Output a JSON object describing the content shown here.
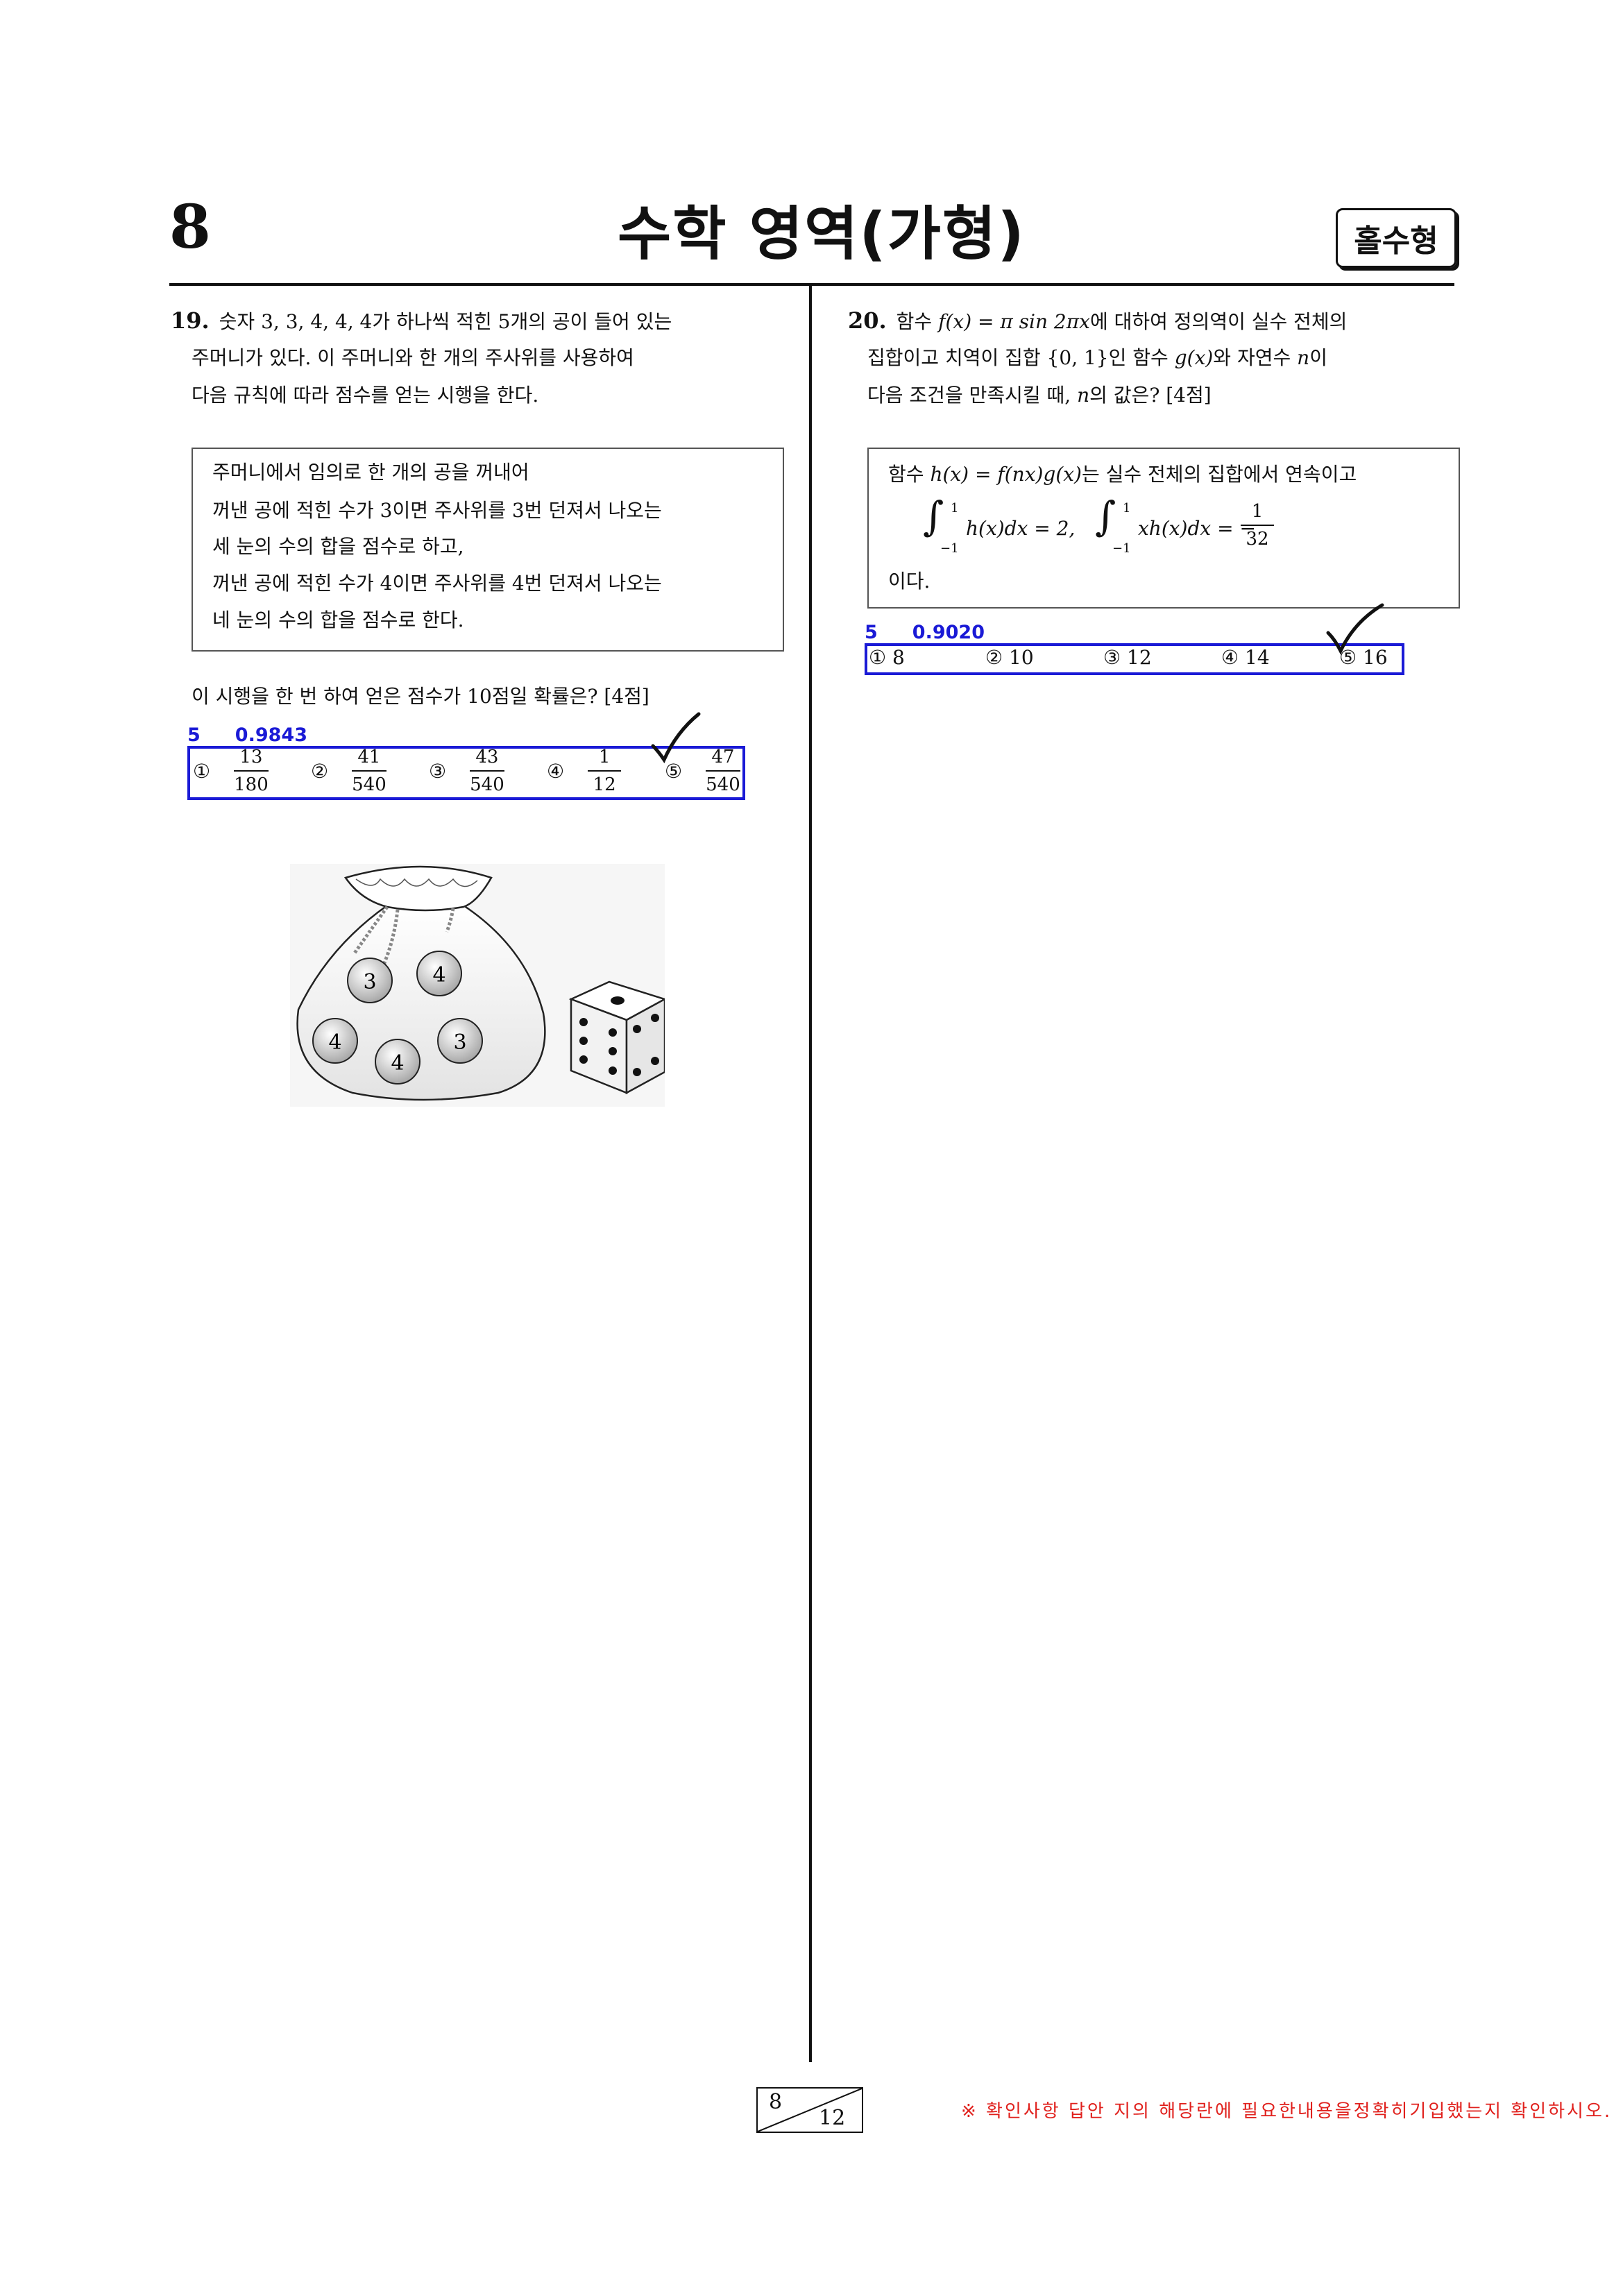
{
  "header": {
    "page_number": "8",
    "title": "수학 영역(가형)",
    "exam_type": "홀수형"
  },
  "q19": {
    "number": "19.",
    "lines": [
      "숫자 3, 3, 4, 4, 4가 하나씩 적힌 5개의 공이 들어 있는",
      "주머니가 있다. 이 주머니와 한 개의 주사위를 사용하여",
      "다음 규칙에 따라 점수를 얻는 시행을 한다."
    ],
    "rule_lines": [
      "주머니에서 임의로 한 개의 공을 꺼내어",
      "꺼낸 공에 적힌 수가 3이면 주사위를 3번 던져서 나오는",
      "세 눈의 수의 합을 점수로 하고,",
      "꺼낸 공에 적힌 수가 4이면 주사위를 4번 던져서 나오는",
      "네 눈의 수의 합을 점수로 한다."
    ],
    "question": "이 시행을 한 번 하여 얻은 점수가 10점일 확률은? [4점]",
    "answer": "5",
    "confidence": "0.9843",
    "choices": [
      {
        "mark": "①",
        "num": "13",
        "den": "180"
      },
      {
        "mark": "②",
        "num": "41",
        "den": "540"
      },
      {
        "mark": "③",
        "num": "43",
        "den": "540"
      },
      {
        "mark": "④",
        "num": "1",
        "den": "12"
      },
      {
        "mark": "⑤",
        "num": "47",
        "den": "540"
      }
    ],
    "balls": [
      "3",
      "4",
      "4",
      "3",
      "4"
    ]
  },
  "q20": {
    "number": "20.",
    "line1_a": "함수",
    "line1_f": "f(x) = π sin 2πx",
    "line1_b": "에 대하여 정의역이 실수 전체의",
    "line2_a": "집합이고 치역이 집합",
    "line2_set": "{0, 1}",
    "line2_b": "인 함수",
    "line2_g": "g(x)",
    "line2_c": "와 자연수",
    "line2_n": "n",
    "line2_d": "이",
    "line3_a": "다음 조건을 만족시킬 때,",
    "line3_n": "n",
    "line3_b": "의 값은? [4점]",
    "cond_a": "함수",
    "cond_h": "h(x) = f(nx)g(x)",
    "cond_b": "는 실수 전체의 집합에서 연속이고",
    "int1_body": "h(x)dx = 2,",
    "int2_body": "xh(x)dx = −",
    "int_upper": "1",
    "int_lower": "−1",
    "frac_num": "1",
    "frac_den": "32",
    "cond_end": "이다.",
    "answer": "5",
    "confidence": "0.9020",
    "choices": [
      {
        "mark": "①",
        "value": "8"
      },
      {
        "mark": "②",
        "value": "10"
      },
      {
        "mark": "③",
        "value": "12"
      },
      {
        "mark": "④",
        "value": "14"
      },
      {
        "mark": "⑤",
        "value": "16"
      }
    ]
  },
  "footer": {
    "current_page": "8",
    "total_pages": "12",
    "note": "※ 확인사항 답안 지의 해당란에 필요한내용을정확히기입했는지 확인하시오."
  },
  "colors": {
    "answer_blue": "#1a1ad6",
    "footer_red": "#e0201c"
  }
}
